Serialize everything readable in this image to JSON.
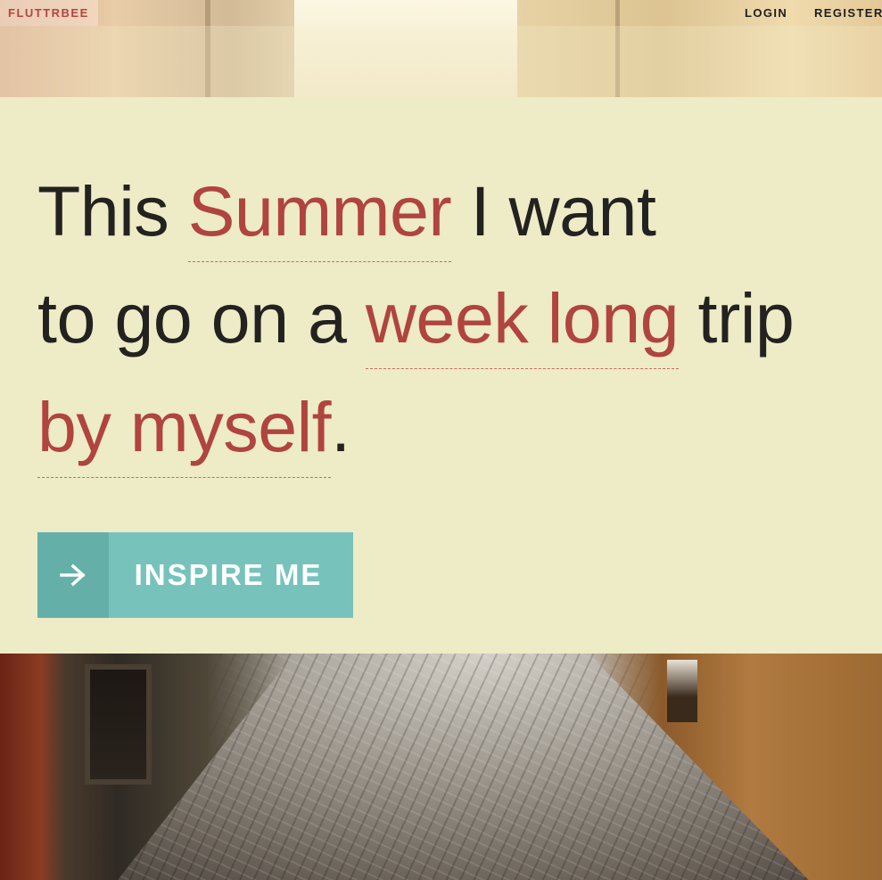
{
  "nav": {
    "logo": "FLUTTRBEE",
    "login": "LOGIN",
    "register": "REGISTER"
  },
  "hero": {
    "line1": {
      "before": "This ",
      "pick": "Summer",
      "after": " I want"
    },
    "line2": {
      "before": "to go on a ",
      "pick": "week long",
      "after": " trip"
    },
    "line3": {
      "pick": "by myself",
      "after": "."
    },
    "cta_label": "INSPIRE ME",
    "cta_icon": "arrow-right-icon"
  },
  "colors": {
    "panel": "#eeebc7",
    "accent_red": "#b0443f",
    "button": "#77c3bb",
    "button_icon_bg": "#64b0a8",
    "text": "#232220"
  }
}
